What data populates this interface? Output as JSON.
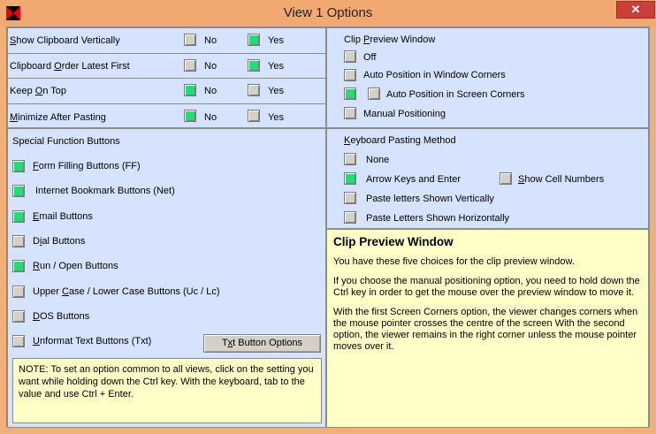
{
  "window": {
    "title": "View 1 Options",
    "close_glyph": "✕",
    "accent_color": "#f2a871",
    "close_color": "#c7403a",
    "checked_color": "#22dd77"
  },
  "prefs": {
    "no_label": "No",
    "yes_label": "Yes",
    "rows": [
      {
        "label": "Show Clipboard Vertically",
        "selected": "no"
      },
      {
        "label": "Clipboard Order Latest First",
        "selected": "yes"
      },
      {
        "label": "Keep On Top",
        "selected": "no"
      },
      {
        "label": "Minimize After Pasting",
        "selected": "no"
      }
    ]
  },
  "clip_preview": {
    "heading": "Clip Preview Window",
    "options": [
      {
        "label": "Off",
        "checked": false
      },
      {
        "label": "Auto Position in Window Corners",
        "checked": false
      },
      {
        "label": "Auto Position in Screen Corners",
        "checked": true
      },
      {
        "label": "Manual Positioning",
        "checked": false
      }
    ]
  },
  "special": {
    "heading": "Special Function Buttons",
    "items": [
      {
        "label": "Form Filling Buttons (FF)",
        "checked": true
      },
      {
        "label": "Internet Bookmark Buttons (Net)",
        "checked": true
      },
      {
        "label": "Email Buttons",
        "checked": true
      },
      {
        "label": "Dial Buttons",
        "checked": false
      },
      {
        "label": "Run / Open Buttons",
        "checked": true
      },
      {
        "label": "Upper Case / Lower Case Buttons (Uc / Lc)",
        "checked": false
      },
      {
        "label": "DOS Buttons",
        "checked": false
      },
      {
        "label": "Unformat Text Buttons (Txt)",
        "checked": false
      }
    ],
    "txt_button_label": "Txt Button Options"
  },
  "keyboard": {
    "heading": "Keyboard Pasting Method",
    "options": [
      {
        "label": "None",
        "checked": false
      },
      {
        "label": "Arrow Keys and Enter",
        "checked": true
      },
      {
        "label": "Paste letters Shown Vertically",
        "checked": false
      },
      {
        "label": "Paste Letters Shown Horizontally",
        "checked": false
      }
    ],
    "show_cell_numbers_label": "Show Cell Numbers"
  },
  "note": {
    "text": "NOTE:  To set an option common to all views, click on the setting you want while holding down the Ctrl key. With the keyboard, tab to the value and use Ctrl + Enter."
  },
  "help": {
    "title": "Clip Preview Window",
    "p1": "You have these five choices for the clip preview window.",
    "p2": "If you choose the manual positioning option, you need to hold down the Ctrl key in order to get the mouse over the preview window to move it.",
    "p3": "With the first Screen Corners option, the viewer changes corners when the mouse pointer crosses the centre of the screen With the second option, the viewer remains in the right corner unless the mouse pointer moves over it."
  }
}
